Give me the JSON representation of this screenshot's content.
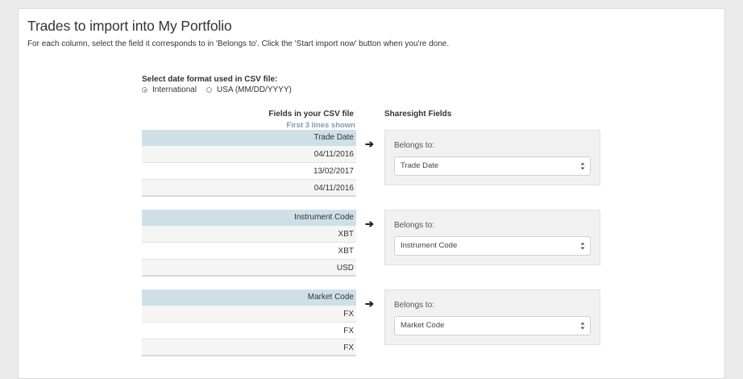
{
  "page": {
    "title": "Trades to import into My Portfolio",
    "instructions": "For each column, select the field it corresponds to in 'Belongs to'. Click the 'Start import now' button when you're done."
  },
  "date_format": {
    "label": "Select date format used in CSV file:",
    "options": [
      {
        "label": "International",
        "selected": true
      },
      {
        "label": "USA (MM/DD/YYYY)",
        "selected": false
      }
    ]
  },
  "columns": {
    "csv_header": "Fields in your CSV file",
    "csv_subheader": "First 3 lines shown",
    "sharesight_header": "Sharesight Fields"
  },
  "mappings": [
    {
      "csv_field": "Trade Date",
      "rows": [
        "04/11/2016",
        "13/02/2017",
        "04/11/2016"
      ],
      "belongs_label": "Belongs to:",
      "selected": "Trade Date"
    },
    {
      "csv_field": "Instrument Code",
      "rows": [
        "XBT",
        "XBT",
        "USD"
      ],
      "belongs_label": "Belongs to:",
      "selected": "Instrument Code"
    },
    {
      "csv_field": "Market Code",
      "rows": [
        "FX",
        "FX",
        "FX"
      ],
      "belongs_label": "Belongs to:",
      "selected": "Market Code"
    }
  ],
  "icons": {
    "arrow": "arrow-right-icon",
    "select_caret": "chevron-up-down-icon"
  },
  "colors": {
    "csv_header_bg": "#cfdfe6",
    "subheader_text": "#8a9aa8"
  }
}
